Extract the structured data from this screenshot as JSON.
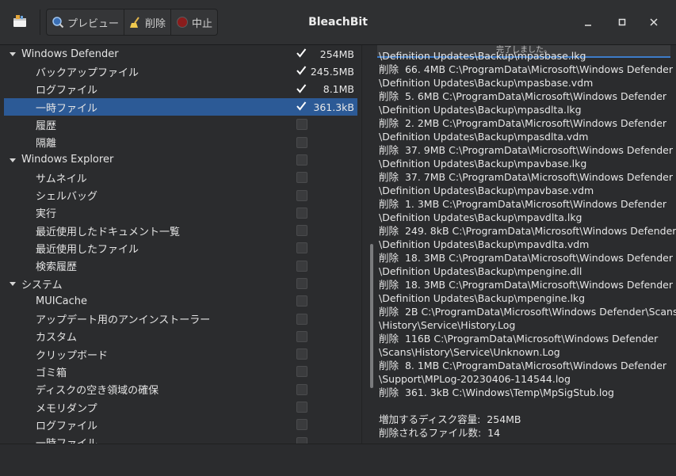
{
  "window": {
    "title": "BleachBit"
  },
  "toolbar": {
    "preview_label": "プレビュー",
    "delete_label": "削除",
    "stop_label": "中止"
  },
  "tree": [
    {
      "label": "Windows Defender",
      "level": 0,
      "expanded": true,
      "checked": true,
      "size": "254MB"
    },
    {
      "label": "バックアップファイル",
      "level": 1,
      "checked": true,
      "size": "245.5MB"
    },
    {
      "label": "ログファイル",
      "level": 1,
      "checked": true,
      "size": "8.1MB"
    },
    {
      "label": "一時ファイル",
      "level": 1,
      "checked": true,
      "size": "361.3kB",
      "selected": true
    },
    {
      "label": "履歴",
      "level": 1,
      "checked": false,
      "size": ""
    },
    {
      "label": "隔離",
      "level": 1,
      "checked": false,
      "size": ""
    },
    {
      "label": "Windows Explorer",
      "level": 0,
      "expanded": true,
      "checked": false,
      "size": ""
    },
    {
      "label": "サムネイル",
      "level": 1,
      "checked": false,
      "size": ""
    },
    {
      "label": "シェルバッグ",
      "level": 1,
      "checked": false,
      "size": ""
    },
    {
      "label": "実行",
      "level": 1,
      "checked": false,
      "size": ""
    },
    {
      "label": "最近使用したドキュメント一覧",
      "level": 1,
      "checked": false,
      "size": ""
    },
    {
      "label": "最近使用したファイル",
      "level": 1,
      "checked": false,
      "size": ""
    },
    {
      "label": "検索履歴",
      "level": 1,
      "checked": false,
      "size": ""
    },
    {
      "label": "システム",
      "level": 0,
      "expanded": true,
      "checked": false,
      "size": ""
    },
    {
      "label": "MUICache",
      "level": 1,
      "checked": false,
      "size": ""
    },
    {
      "label": "アップデート用のアンインストーラー",
      "level": 1,
      "checked": false,
      "size": ""
    },
    {
      "label": "カスタム",
      "level": 1,
      "checked": false,
      "size": ""
    },
    {
      "label": "クリップボード",
      "level": 1,
      "checked": false,
      "size": ""
    },
    {
      "label": "ゴミ箱",
      "level": 1,
      "checked": false,
      "size": ""
    },
    {
      "label": "ディスクの空き領域の確保",
      "level": 1,
      "checked": false,
      "size": ""
    },
    {
      "label": "メモリダンプ",
      "level": 1,
      "checked": false,
      "size": ""
    },
    {
      "label": "ログファイル",
      "level": 1,
      "checked": false,
      "size": ""
    },
    {
      "label": "一時ファイル",
      "level": 1,
      "checked": false,
      "size": ""
    }
  ],
  "progress": {
    "text": "完了しました。",
    "fraction": 1.0
  },
  "log": [
    "\\Definition Updates\\Backup\\mpasbase.lkg",
    "削除  66. 4MB C:\\ProgramData\\Microsoft\\Windows Defender",
    "\\Definition Updates\\Backup\\mpasbase.vdm",
    "削除  5. 6MB C:\\ProgramData\\Microsoft\\Windows Defender",
    "\\Definition Updates\\Backup\\mpasdlta.lkg",
    "削除  2. 2MB C:\\ProgramData\\Microsoft\\Windows Defender",
    "\\Definition Updates\\Backup\\mpasdlta.vdm",
    "削除  37. 9MB C:\\ProgramData\\Microsoft\\Windows Defender",
    "\\Definition Updates\\Backup\\mpavbase.lkg",
    "削除  37. 7MB C:\\ProgramData\\Microsoft\\Windows Defender",
    "\\Definition Updates\\Backup\\mpavbase.vdm",
    "削除  1. 3MB C:\\ProgramData\\Microsoft\\Windows Defender",
    "\\Definition Updates\\Backup\\mpavdlta.lkg",
    "削除  249. 8kB C:\\ProgramData\\Microsoft\\Windows Defender",
    "\\Definition Updates\\Backup\\mpavdlta.vdm",
    "削除  18. 3MB C:\\ProgramData\\Microsoft\\Windows Defender",
    "\\Definition Updates\\Backup\\mpengine.dll",
    "削除  18. 3MB C:\\ProgramData\\Microsoft\\Windows Defender",
    "\\Definition Updates\\Backup\\mpengine.lkg",
    "削除  2B C:\\ProgramData\\Microsoft\\Windows Defender\\Scans",
    "\\History\\Service\\History.Log",
    "削除  116B C:\\ProgramData\\Microsoft\\Windows Defender",
    "\\Scans\\History\\Service\\Unknown.Log",
    "削除  8. 1MB C:\\ProgramData\\Microsoft\\Windows Defender",
    "\\Support\\MPLog-20230406-114544.log",
    "削除  361. 3kB C:\\Windows\\Temp\\MpSigStub.log",
    "",
    "増加するディスク容量:  254MB",
    "削除されるファイル数:  14"
  ],
  "colors": {
    "selection": "#2c5a96",
    "progress": "#3d7cc9"
  }
}
